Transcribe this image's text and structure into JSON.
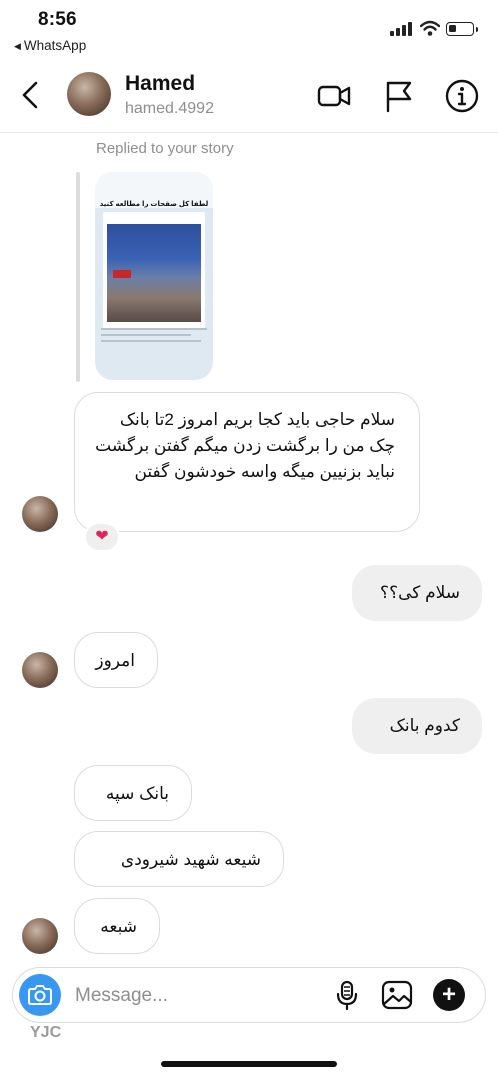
{
  "status": {
    "time": "8:56",
    "back_app": "WhatsApp"
  },
  "header": {
    "name": "Hamed",
    "handle": "hamed.4992"
  },
  "story_reply": {
    "label": "Replied to your story",
    "card_title": "لطفا کل صفحات را مطالعه کنید"
  },
  "messages": [
    {
      "side": "in",
      "text": "سلام حاجی باید کجا بریم امروز 2تا بانک چک من را برگشت زدن میگم گفتن برگشت نباید بزنیین میگه واسه خودشون گفتن",
      "reaction": "heart-icon"
    },
    {
      "side": "out",
      "text": "سلام کی؟؟"
    },
    {
      "side": "in",
      "text": "امروز"
    },
    {
      "side": "out",
      "text": "کدوم بانک"
    },
    {
      "side": "in",
      "text": "بانک سپه"
    },
    {
      "side": "in",
      "text": "شیعه شهید شیرودی"
    },
    {
      "side": "in",
      "text": "شبعه"
    }
  ],
  "composer": {
    "placeholder": "Message..."
  },
  "watermark": "YJC",
  "icons": [
    "back-icon",
    "video-call-icon",
    "flag-icon",
    "info-icon",
    "camera-icon",
    "microphone-icon",
    "gallery-icon",
    "plus-icon",
    "heart-icon"
  ],
  "colors": {
    "accent": "#3897f0",
    "bubble_out": "#efefef",
    "bubble_in_border": "#dbdbdb",
    "muted_text": "#8e8e8e"
  }
}
